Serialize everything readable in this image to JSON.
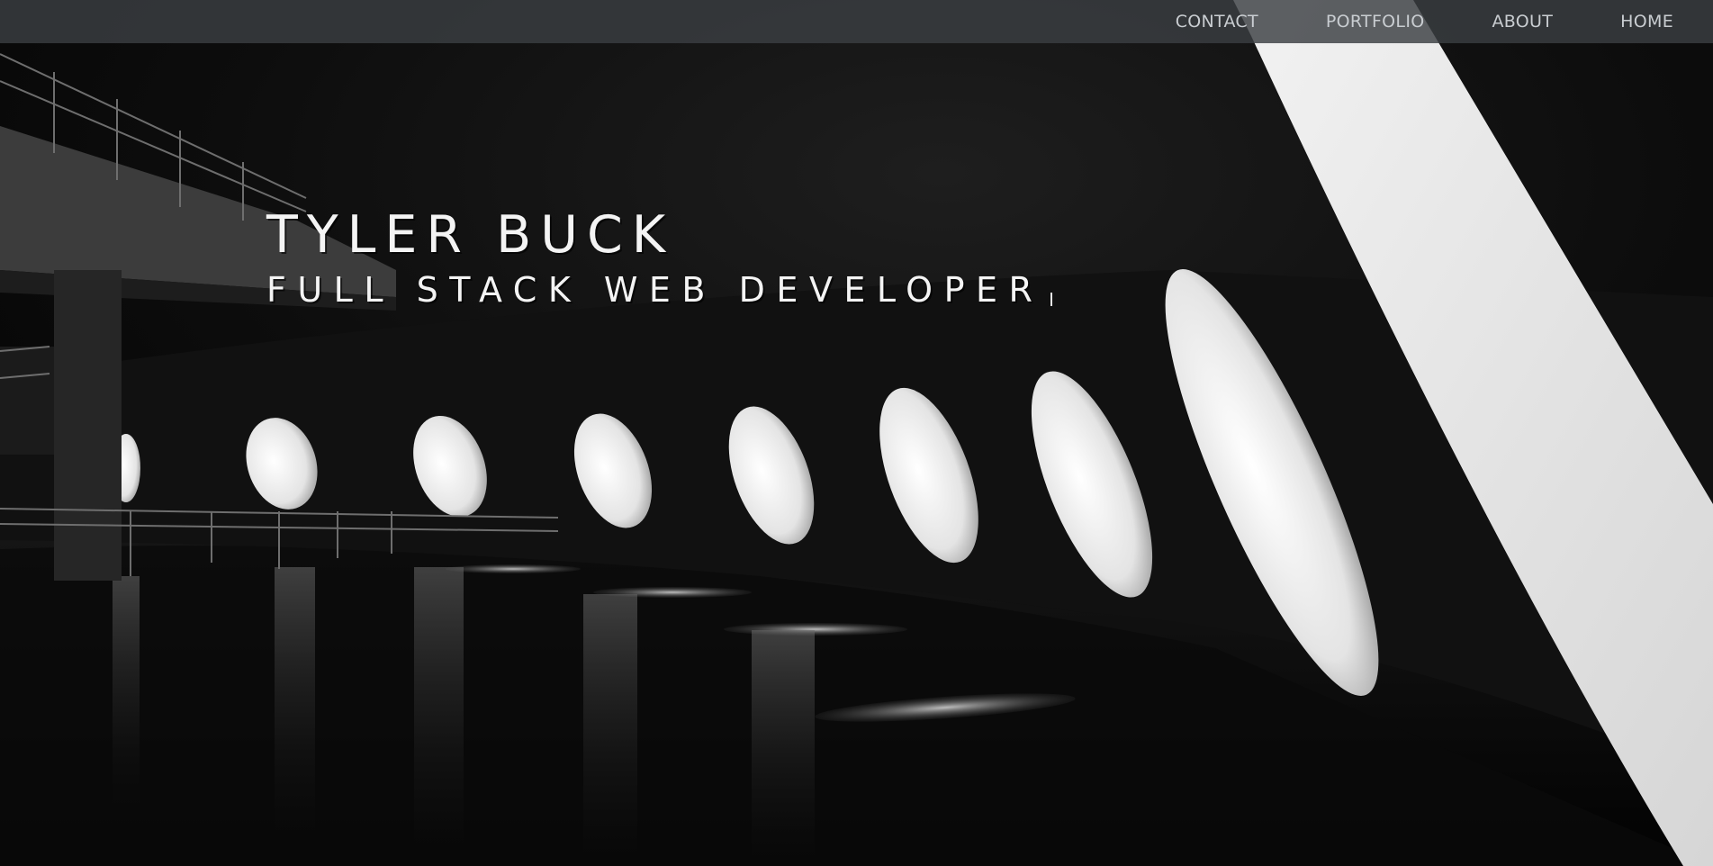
{
  "nav": {
    "items": [
      {
        "label": "CONTACT"
      },
      {
        "label": "PORTFOLIO"
      },
      {
        "label": "ABOUT"
      },
      {
        "label": "HOME"
      }
    ]
  },
  "hero": {
    "name": "TYLER BUCK",
    "title": "FULL STACK WEB DEVELOPER"
  },
  "colors": {
    "navbar_bg": "#3a3e42",
    "nav_text": "#c9cdd1",
    "hero_text": "#f4f4f4",
    "background": "#050505"
  },
  "background_image": "black-and-white architectural interior with oval windows and a diagonal light beam"
}
